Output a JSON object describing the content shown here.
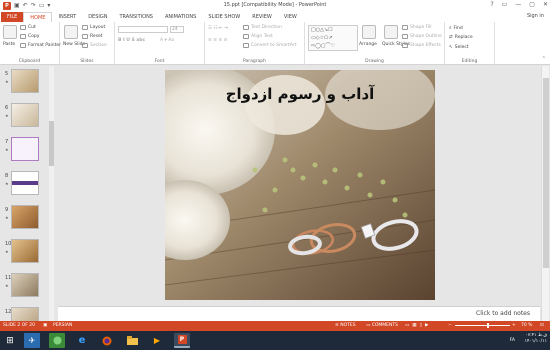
{
  "window": {
    "title": "15.ppt [Compatibility Mode] - PowerPoint",
    "controls": [
      "?",
      "▭",
      "—",
      "▢",
      "✕"
    ]
  },
  "qat": {
    "logo": "P"
  },
  "tabs": [
    "FILE",
    "HOME",
    "INSERT",
    "DESIGN",
    "TRANSITIONS",
    "ANIMATIONS",
    "SLIDE SHOW",
    "REVIEW",
    "VIEW"
  ],
  "sign_in": "Sign in",
  "ribbon": {
    "clipboard": {
      "paste": "Paste",
      "cut": "Cut",
      "copy": "Copy",
      "format_painter": "Format Painter",
      "label": "Clipboard"
    },
    "slides": {
      "new_slide": "New Slide",
      "layout": "Layout",
      "reset": "Reset",
      "section": "Section",
      "label": "Slides"
    },
    "font": {
      "size": "24",
      "label": "Font"
    },
    "paragraph": {
      "text_direction": "Text Direction",
      "align_text": "Align Text",
      "convert_smartart": "Convert to SmartArt",
      "label": "Paragraph"
    },
    "drawing": {
      "arrange": "Arrange",
      "quick_styles": "Quick Styles",
      "shape_fill": "Shape Fill",
      "shape_outline": "Shape Outline",
      "shape_effects": "Shape Effects",
      "label": "Drawing"
    },
    "editing": {
      "find": "Find",
      "replace": "Replace",
      "select": "Select",
      "label": "Editing"
    }
  },
  "thumbnails": [
    {
      "num": "5",
      "star": "★"
    },
    {
      "num": "6",
      "star": "★"
    },
    {
      "num": "7",
      "star": "★"
    },
    {
      "num": "8",
      "star": "★"
    },
    {
      "num": "9",
      "star": "★"
    },
    {
      "num": "10",
      "star": "★"
    },
    {
      "num": "11",
      "star": "★"
    },
    {
      "num": "12",
      "star": ""
    }
  ],
  "slide": {
    "title": "آداب و رسوم ازدواج"
  },
  "notes_placeholder": "Click to add notes",
  "status": {
    "slide": "SLIDE 2 OF 20",
    "language": "PERSIAN",
    "notes": "NOTES",
    "comments": "COMMENTS",
    "zoom": "70 %"
  },
  "tray": {
    "lang": "FA",
    "time": "۰۷:۴۱ ق.ظ",
    "date": "۱۴۰۱/۱۰/۱۱"
  },
  "colors": {
    "accent": "#d24726",
    "taskbar": "#1e2a3a"
  }
}
